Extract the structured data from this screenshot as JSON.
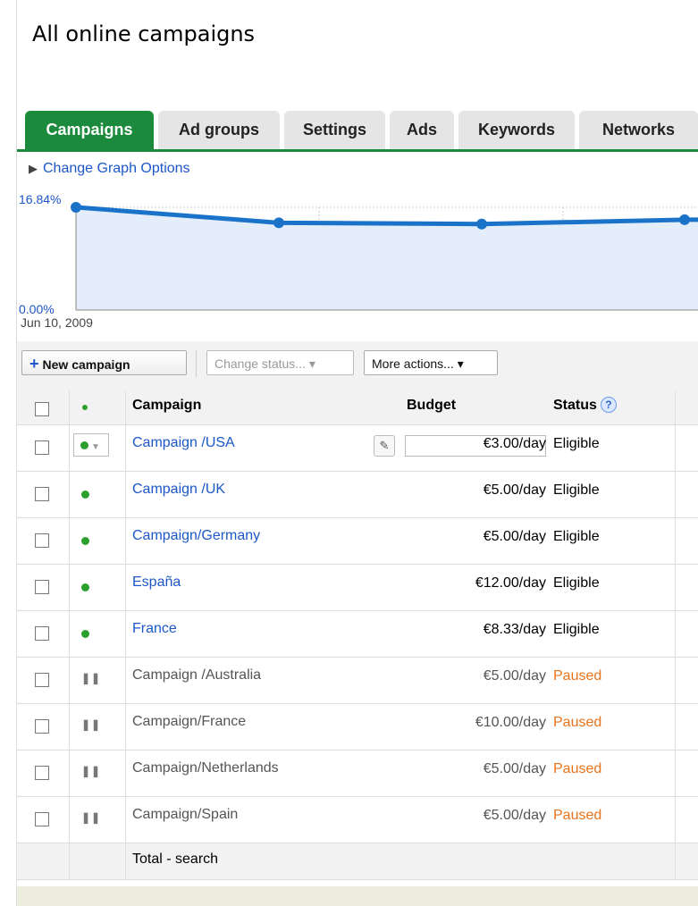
{
  "page": {
    "title": "All online campaigns"
  },
  "tabs": [
    {
      "label": "Campaigns",
      "active": true
    },
    {
      "label": "Ad groups"
    },
    {
      "label": "Settings"
    },
    {
      "label": "Ads"
    },
    {
      "label": "Keywords"
    },
    {
      "label": "Networks"
    }
  ],
  "graph_options": {
    "label": "Change Graph Options",
    "icon": "triangle-right-icon"
  },
  "chart_data": {
    "type": "area",
    "y_top_label": "16.84%",
    "y_bottom_label": "0.00%",
    "x_start_label": "Jun 10, 2009",
    "ylim": [
      0,
      16.84
    ],
    "values": [
      16.84,
      14.3,
      14.1,
      14.8
    ],
    "line_color": "#1a73c9",
    "fill_color": "#e3eefa"
  },
  "toolbar": {
    "new_campaign": "New campaign",
    "change_status": "Change status...",
    "more_actions": "More actions..."
  },
  "table": {
    "columns": {
      "campaign": "Campaign",
      "budget": "Budget",
      "status": "Status"
    },
    "rows": [
      {
        "name": "Campaign /USA",
        "budget": "€3.00/day",
        "status": "Eligible",
        "state": "active"
      },
      {
        "name": "Campaign /UK",
        "budget": "€5.00/day",
        "status": "Eligible",
        "state": "active"
      },
      {
        "name": "Campaign/Germany",
        "budget": "€5.00/day",
        "status": "Eligible",
        "state": "active"
      },
      {
        "name": "España",
        "budget": "€12.00/day",
        "status": "Eligible",
        "state": "active"
      },
      {
        "name": "France",
        "budget": "€8.33/day",
        "status": "Eligible",
        "state": "active"
      },
      {
        "name": "Campaign /Australia",
        "budget": "€5.00/day",
        "status": "Paused",
        "state": "paused"
      },
      {
        "name": "Campaign/France",
        "budget": "€10.00/day",
        "status": "Paused",
        "state": "paused"
      },
      {
        "name": "Campaign/Netherlands",
        "budget": "€5.00/day",
        "status": "Paused",
        "state": "paused"
      },
      {
        "name": "Campaign/Spain",
        "budget": "€5.00/day",
        "status": "Paused",
        "state": "paused"
      }
    ],
    "total_label": "Total - search"
  },
  "colors": {
    "accent_green": "#1b8a3c",
    "link_blue": "#1c57c8",
    "paused_orange": "#e8731a"
  }
}
